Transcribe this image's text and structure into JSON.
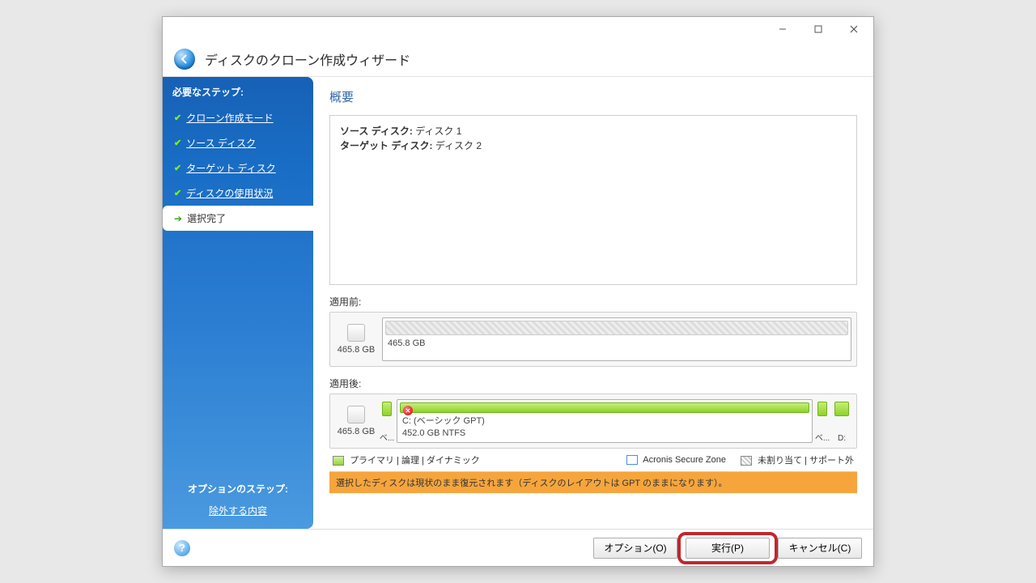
{
  "header": {
    "title": "ディスクのクローン作成ウィザード"
  },
  "sidebar": {
    "required_heading": "必要なステップ:",
    "steps": [
      {
        "label": "クローン作成モード",
        "done": true
      },
      {
        "label": "ソース ディスク",
        "done": true
      },
      {
        "label": "ターゲット ディスク",
        "done": true
      },
      {
        "label": "ディスクの使用状況",
        "done": true
      }
    ],
    "current_step": "選択完了",
    "optional_heading": "オプションのステップ:",
    "optional_link": "除外する内容"
  },
  "main": {
    "title": "概要",
    "source_label": "ソース ディスク:",
    "source_value": "ディスク 1",
    "target_label": "ターゲット ディスク:",
    "target_value": "ディスク 2",
    "before_label": "適用前:",
    "after_label": "適用後:",
    "before": {
      "size": "465.8 GB",
      "part_size": "465.8 GB"
    },
    "after": {
      "size": "465.8 GB",
      "small_left": "ベ...",
      "main_name": "C: (ベーシック GPT)",
      "main_sub": "452.0 GB  NTFS",
      "small_right1": "ベ...",
      "small_right2": "D:"
    },
    "legend": {
      "primary": "プライマリ",
      "logical": "論理",
      "dynamic": "ダイナミック",
      "asz": "Acronis Secure Zone",
      "unalloc": "未割り当て",
      "unsupported": "サポート外"
    },
    "warn": "選択したディスクは現状のまま復元されます（ディスクのレイアウトは GPT のままになります）。"
  },
  "footer": {
    "options": "オプション(O)",
    "proceed": "実行(P)",
    "cancel": "キャンセル(C)"
  }
}
